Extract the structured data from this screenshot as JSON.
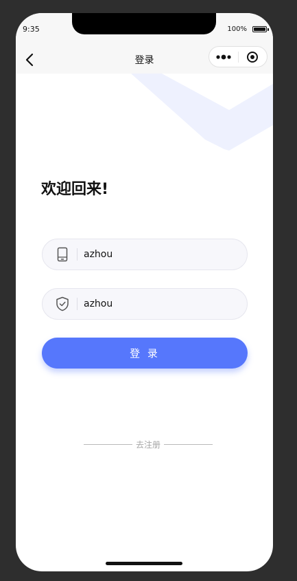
{
  "status_bar": {
    "time": "9:35",
    "battery_text": "100%",
    "battery_level": 1.0
  },
  "nav": {
    "title": "登录",
    "back_icon": "chevron-left-icon",
    "more_icon": "more-dots-icon",
    "close_icon": "target-circle-icon"
  },
  "main": {
    "welcome": "欢迎回来!",
    "phone_field": {
      "icon": "phone-icon",
      "value": "azhou"
    },
    "code_field": {
      "icon": "shield-check-icon",
      "value": "azhou"
    },
    "login_label": "登 录",
    "register_label": "去注册"
  },
  "colors": {
    "accent": "#5677fc",
    "field_background": "#f7f7fb",
    "decoration": "#eef1fe",
    "nav_background": "#f7f7f7"
  }
}
